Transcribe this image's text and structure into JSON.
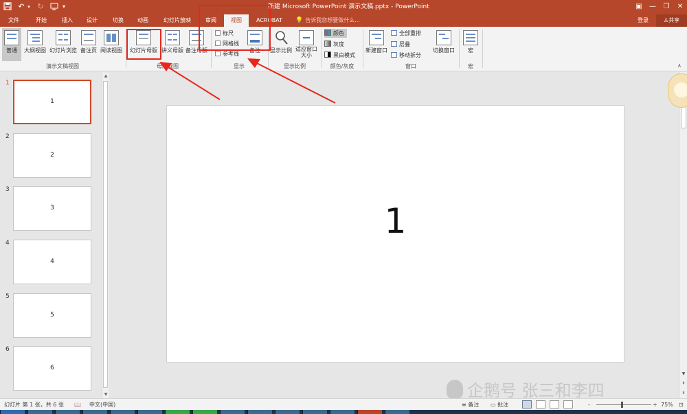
{
  "titlebar": {
    "title": "新建 Microsoft PowerPoint 演示文稿.pptx - PowerPoint",
    "save_icon": "save-icon",
    "undo_label": "↶",
    "redo_label": "↻",
    "min_label": "—",
    "restore_label": "❐",
    "close_label": "✕",
    "ribbon_opt_label": "▣",
    "bg_color": "#b7472a"
  },
  "tabs": [
    {
      "label": "文件"
    },
    {
      "label": "开始"
    },
    {
      "label": "插入"
    },
    {
      "label": "设计"
    },
    {
      "label": "切换"
    },
    {
      "label": "动画"
    },
    {
      "label": "幻灯片放映"
    },
    {
      "label": "审阅"
    },
    {
      "label": "视图",
      "active": true
    },
    {
      "label": "ACROBAT"
    }
  ],
  "tellme": "告诉我您想要做什么...",
  "account": {
    "login": "登录",
    "share": "共享"
  },
  "ribbon": {
    "presentation_views": {
      "buttons": [
        "普通",
        "大纲视图",
        "幻灯片浏览",
        "备注页",
        "阅读视图"
      ],
      "group_label": "演示文稿视图"
    },
    "master_views": {
      "buttons": [
        "幻灯片母版",
        "讲义母版",
        "备注母版"
      ],
      "group_label": "母版视图"
    },
    "show": {
      "checks": [
        "标尺",
        "网格线",
        "参考线"
      ],
      "notes_label": "备注",
      "group_label": "显示"
    },
    "zoom": {
      "buttons": [
        "显示比例",
        "适应窗口大小"
      ],
      "group_label": "显示比例"
    },
    "color": {
      "items": [
        "颜色",
        "灰度",
        "黑白模式"
      ],
      "group_label": "颜色/灰度"
    },
    "window": {
      "new_window": "新建窗口",
      "items": [
        "全部重排",
        "层叠",
        "移动拆分"
      ],
      "group_label": "窗口"
    },
    "switch": {
      "label": "切换窗口"
    },
    "macro": {
      "label": "宏",
      "group_label": "宏"
    }
  },
  "slides": [
    {
      "num": "1",
      "text": "1",
      "active": true
    },
    {
      "num": "2",
      "text": "2"
    },
    {
      "num": "3",
      "text": "3"
    },
    {
      "num": "4",
      "text": "4"
    },
    {
      "num": "5",
      "text": "5"
    },
    {
      "num": "6",
      "text": "6"
    }
  ],
  "current_slide": {
    "text": "1"
  },
  "statusbar": {
    "slide_info": "幻灯片 第 1 张，共 6 张",
    "language": "中文(中国)",
    "notes": "备注",
    "comments": "批注",
    "zoom": "75%",
    "minus": "-",
    "plus": "+"
  },
  "watermark": "企鹅号 张三和李四",
  "colors": {
    "accent": "#b7472a",
    "highlight": "#e8261c",
    "active_thumb": "#d24726"
  }
}
